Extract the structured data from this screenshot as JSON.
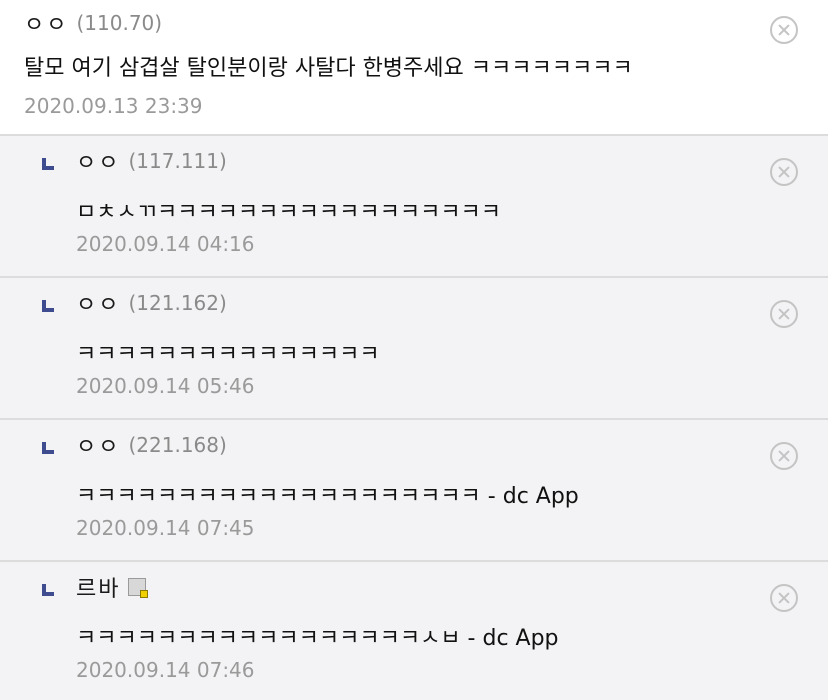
{
  "comments": [
    {
      "nick": "ㅇㅇ",
      "ip": "(110.70)",
      "content": "탈모 여기 삼겹살 탈인분이랑 사탈다 한병주세요 ㅋㅋㅋㅋㅋㅋㅋㅋ",
      "date": "2020.09.13 23:39"
    }
  ],
  "replies": [
    {
      "nick": "ㅇㅇ",
      "ip": "(117.111)",
      "content": "ㅁㅊㅅㄲㅋㅋㅋㅋㅋㅋㅋㅋㅋㅋㅋㅋㅋㅋㅋㅋㅋ",
      "date": "2020.09.14 04:16"
    },
    {
      "nick": "ㅇㅇ",
      "ip": "(121.162)",
      "content": "ㅋㅋㅋㅋㅋㅋㅋㅋㅋㅋㅋㅋㅋㅋㅋ",
      "date": "2020.09.14 05:46"
    },
    {
      "nick": "ㅇㅇ",
      "ip": "(221.168)",
      "content": "ㅋㅋㅋㅋㅋㅋㅋㅋㅋㅋㅋㅋㅋㅋㅋㅋㅋㅋㅋㅋ - dc App",
      "date": "2020.09.14 07:45"
    },
    {
      "nick": "르바",
      "ip": "",
      "content": "ㅋㅋㅋㅋㅋㅋㅋㅋㅋㅋㅋㅋㅋㅋㅋㅋㅋㅅㅂ - dc App",
      "date": "2020.09.14 07:46"
    }
  ],
  "icons": {
    "delete": "circle-x-icon",
    "reply": "reply-arrow-icon",
    "gallery_badge": "gallery-member-icon"
  },
  "colors": {
    "reply_marker": "#3f4b8f",
    "reply_bg": "#f3f3f5",
    "meta_text": "#9a9a9a"
  }
}
